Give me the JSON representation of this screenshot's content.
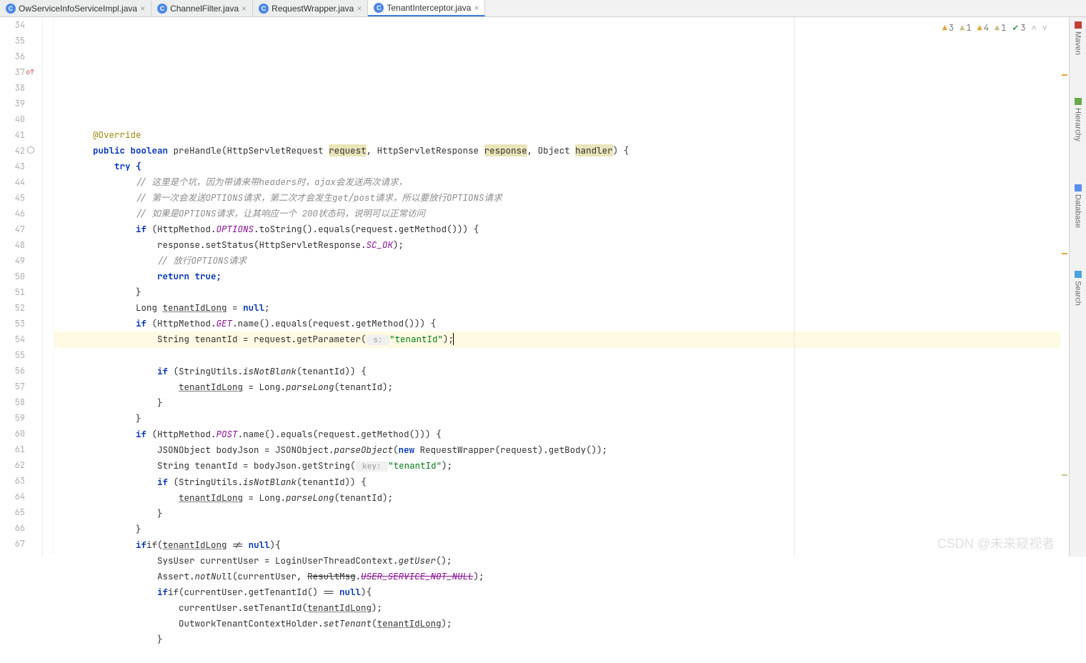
{
  "tabs": [
    {
      "label": "OwServiceInfoServiceImpl.java",
      "active": false
    },
    {
      "label": "ChannelFilter.java",
      "active": false
    },
    {
      "label": "RequestWrapper.java",
      "active": false
    },
    {
      "label": "TenantInterceptor.java",
      "active": true
    }
  ],
  "indicators": {
    "warn1": "3",
    "weak1": "1",
    "warn2": "4",
    "weak2": "1",
    "chk": "3"
  },
  "tools": [
    "Maven",
    "Hierarchy",
    "Database",
    "Search"
  ],
  "lines_start": 34,
  "lines_end": 67,
  "code": {
    "l36": "@Override",
    "l37_pre": "public boolean ",
    "l37_m": "preHandle",
    "l37_p1": "(HttpServletRequest ",
    "l37_r": "request",
    "l37_c1": ", HttpServletResponse ",
    "l37_rs": "response",
    "l37_c2": ", Object ",
    "l37_h": "handler",
    "l37_end": ") {",
    "l38": "try {",
    "l39": "// 这里是个坑，因为带请来带headers时，ajax会发送两次请求，",
    "l40": "// 第一次会发送OPTIONS请求，第二次才会发生get/post请求，所以要放行OPTIONS请求",
    "l41": "// 如果是OPTIONS请求，让其响应一个 200状态码，说明可以正常访问",
    "l42_a": "if (HttpMethod.",
    "l42_b": "OPTIONS",
    "l42_c": ".toString().equals(request.getMethod())) {",
    "l43_a": "response.setStatus(HttpServletResponse.",
    "l43_b": "SC_OK",
    "l43_c": ");",
    "l44": "// 放行OPTIONS请求",
    "l45": "return true;",
    "l46": "}",
    "l47_a": "Long ",
    "l47_b": "tenantIdLong",
    "l47_c": " = ",
    "l47_d": "null",
    "l47_e": ";",
    "l48_a": "if (HttpMethod.",
    "l48_b": "GET",
    "l48_c": ".name().equals(request.getMethod())) {",
    "l49_a": "String tenantId = request.getParameter(",
    "l49_hint": " s: ",
    "l49_b": "\"tenantId\"",
    "l49_c": ");",
    "l50_a": "if (StringUtils.",
    "l50_b": "isNotBlank",
    "l50_c": "(tenantId)) {",
    "l51_a": "tenantIdLong",
    "l51_b": " = Long.",
    "l51_c": "parseLong",
    "l51_d": "(tenantId);",
    "l52": "}",
    "l53": "}",
    "l54_a": "if (HttpMethod.",
    "l54_b": "POST",
    "l54_c": ".name().equals(request.getMethod())) {",
    "l55_a": "JSONObject bodyJson = JSONObject.",
    "l55_b": "parseObject",
    "l55_c": "(",
    "l55_d": "new",
    "l55_e": " RequestWrapper(request).getBody());",
    "l56_a": "String tenantId = bodyJson.getString(",
    "l56_hint": " key: ",
    "l56_b": "\"tenantId\"",
    "l56_c": ");",
    "l57_a": "if (StringUtils.",
    "l57_b": "isNotBlank",
    "l57_c": "(tenantId)) {",
    "l58_a": "tenantIdLong",
    "l58_b": " = Long.",
    "l58_c": "parseLong",
    "l58_d": "(tenantId);",
    "l59": "}",
    "l60": "}",
    "l61_a": "if(",
    "l61_b": "tenantIdLong",
    "l61_c": " != ",
    "l61_d": "null",
    "l61_e": "){",
    "l62_a": "SysUser currentUser = LoginUserThreadContext.",
    "l62_b": "getUser",
    "l62_c": "();",
    "l63_a": "Assert.",
    "l63_b": "notNull",
    "l63_c": "(currentUser, ",
    "l63_d": "ResultMsg",
    "l63_e": ".",
    "l63_f": "USER_SERVICE_NOT_NULL",
    "l63_g": ");",
    "l64_a": "if(currentUser.getTenantId() == ",
    "l64_b": "null",
    "l64_c": "){",
    "l65_a": "currentUser.setTenantId(",
    "l65_b": "tenantIdLong",
    "l65_c": ");",
    "l66_a": "OutworkTenantContextHolder.",
    "l66_b": "setTenant",
    "l66_c": "(",
    "l66_d": "tenantIdLong",
    "l66_e": ");",
    "l67": "}"
  },
  "watermark": "CSDN @未来窥视者"
}
